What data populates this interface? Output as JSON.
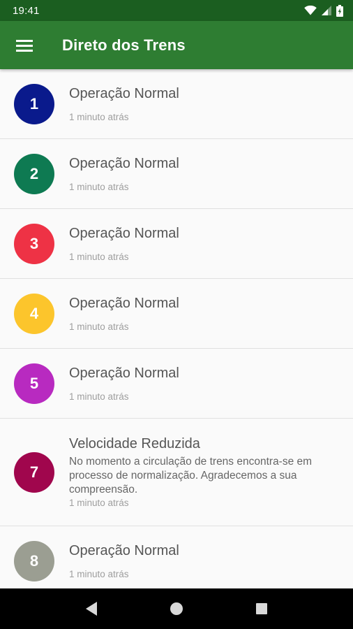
{
  "status_bar": {
    "time": "19:41",
    "icons": [
      "wifi-icon",
      "cell-signal-icon",
      "battery-charging-icon"
    ]
  },
  "app_bar": {
    "menu_icon": "hamburger-menu-icon",
    "title": "Direto dos Trens",
    "color": "#2e7d32",
    "status_color": "#1b5e20"
  },
  "lines": [
    {
      "number": "1",
      "color": "#0a1a8c",
      "status": "Operação Normal",
      "description": "",
      "time": "1 minuto atrás"
    },
    {
      "number": "2",
      "color": "#0e7a52",
      "status": "Operação Normal",
      "description": "",
      "time": "1 minuto atrás"
    },
    {
      "number": "3",
      "color": "#ee3245",
      "status": "Operação Normal",
      "description": "",
      "time": "1 minuto atrás"
    },
    {
      "number": "4",
      "color": "#fcc52c",
      "status": "Operação Normal",
      "description": "",
      "time": "1 minuto atrás"
    },
    {
      "number": "5",
      "color": "#b82ac0",
      "status": "Operação Normal",
      "description": "",
      "time": "1 minuto atrás"
    },
    {
      "number": "7",
      "color": "#a0064d",
      "status": "Velocidade Reduzida",
      "description": "No momento a circulação de trens encontra-se em processo de normalização. Agradecemos a sua compreensão.",
      "time": "1 minuto atrás"
    },
    {
      "number": "8",
      "color": "#9b9e92",
      "status": "Operação Normal",
      "description": "",
      "time": "1 minuto atrás"
    }
  ],
  "nav_bar": {
    "icons": [
      "back-icon",
      "home-icon",
      "recents-icon"
    ]
  }
}
